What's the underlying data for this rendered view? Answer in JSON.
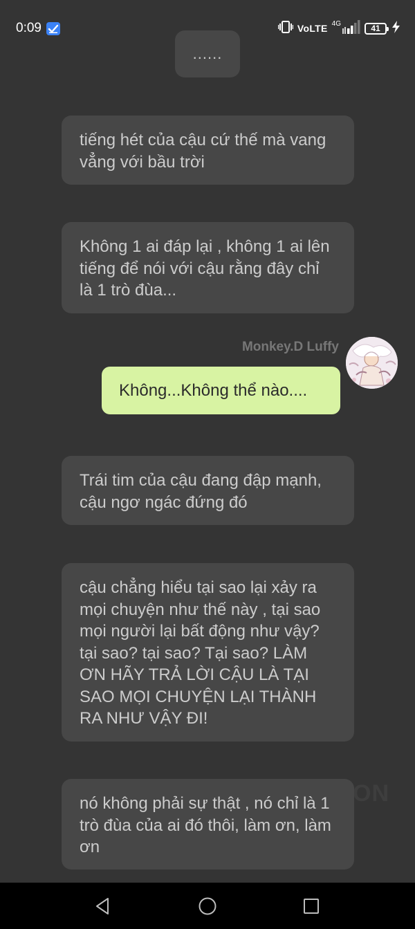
{
  "status_bar": {
    "time": "0:09",
    "volte": "VoLTE",
    "network": "4G",
    "battery": "41"
  },
  "messages": [
    {
      "text": "......"
    },
    {
      "text": "tiếng hét của cậu cứ thế mà vang vẳng với bầu trời"
    },
    {
      "text": "Không 1 ai đáp lại , không 1 ai lên tiếng để nói với cậu rằng đây chỉ là 1 trò đùa..."
    },
    {
      "text": "Trái tim của cậu đang đập mạnh, cậu ngơ ngác đứng đó"
    },
    {
      "text": "cậu chẳng hiểu tại sao lại xảy ra mọi chuyện như thế này , tại sao mọi người lại bất động như vậy? tại sao? tại sao? Tại sao? LÀM ƠN HÃY TRẢ LỜI CẬU LÀ TẠI SAO MỌI CHUYỆN LẠI THÀNH RA NHƯ VẬY ĐI!"
    },
    {
      "text": "nó không phải sự thật , nó chỉ là 1 trò đùa của ai đó thôi, làm ơn, làm ơn"
    }
  ],
  "user_message": {
    "sender": "Monkey.D Luffy",
    "text": "Không...Không thể nào...."
  },
  "watermark": "ON",
  "colors": {
    "background": "#343434",
    "bubble": "#474747",
    "user_bubble": "#d8f3a3",
    "nav_bar": "#000000"
  },
  "icons": {
    "check": "check-badge-icon",
    "vibrate": "vibrate-icon",
    "signal": "signal-icon",
    "charging": "charging-icon",
    "back": "back-icon",
    "home": "home-icon",
    "recent": "recent-apps-icon"
  }
}
